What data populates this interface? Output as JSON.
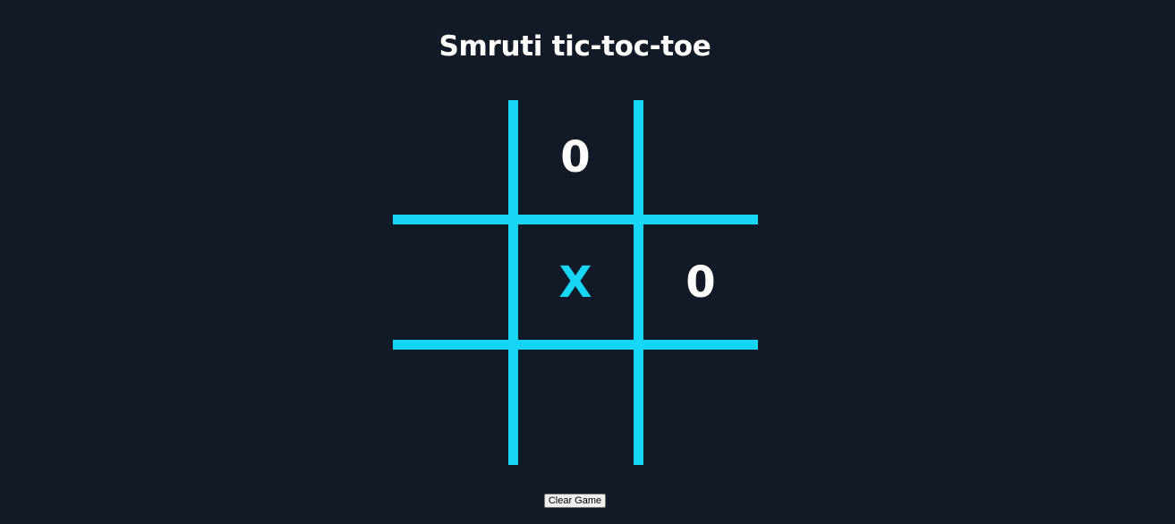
{
  "title": "Smruti tic-toc-toe",
  "board": {
    "cells": [
      "",
      "0",
      "",
      "",
      "X",
      "0",
      "",
      "",
      ""
    ]
  },
  "controls": {
    "clear_label": "Clear Game"
  },
  "colors": {
    "background": "#121a27",
    "grid": "#17d6f5",
    "x_mark": "#17d6f5",
    "o_mark": "#ffffff",
    "title": "#ffffff"
  }
}
